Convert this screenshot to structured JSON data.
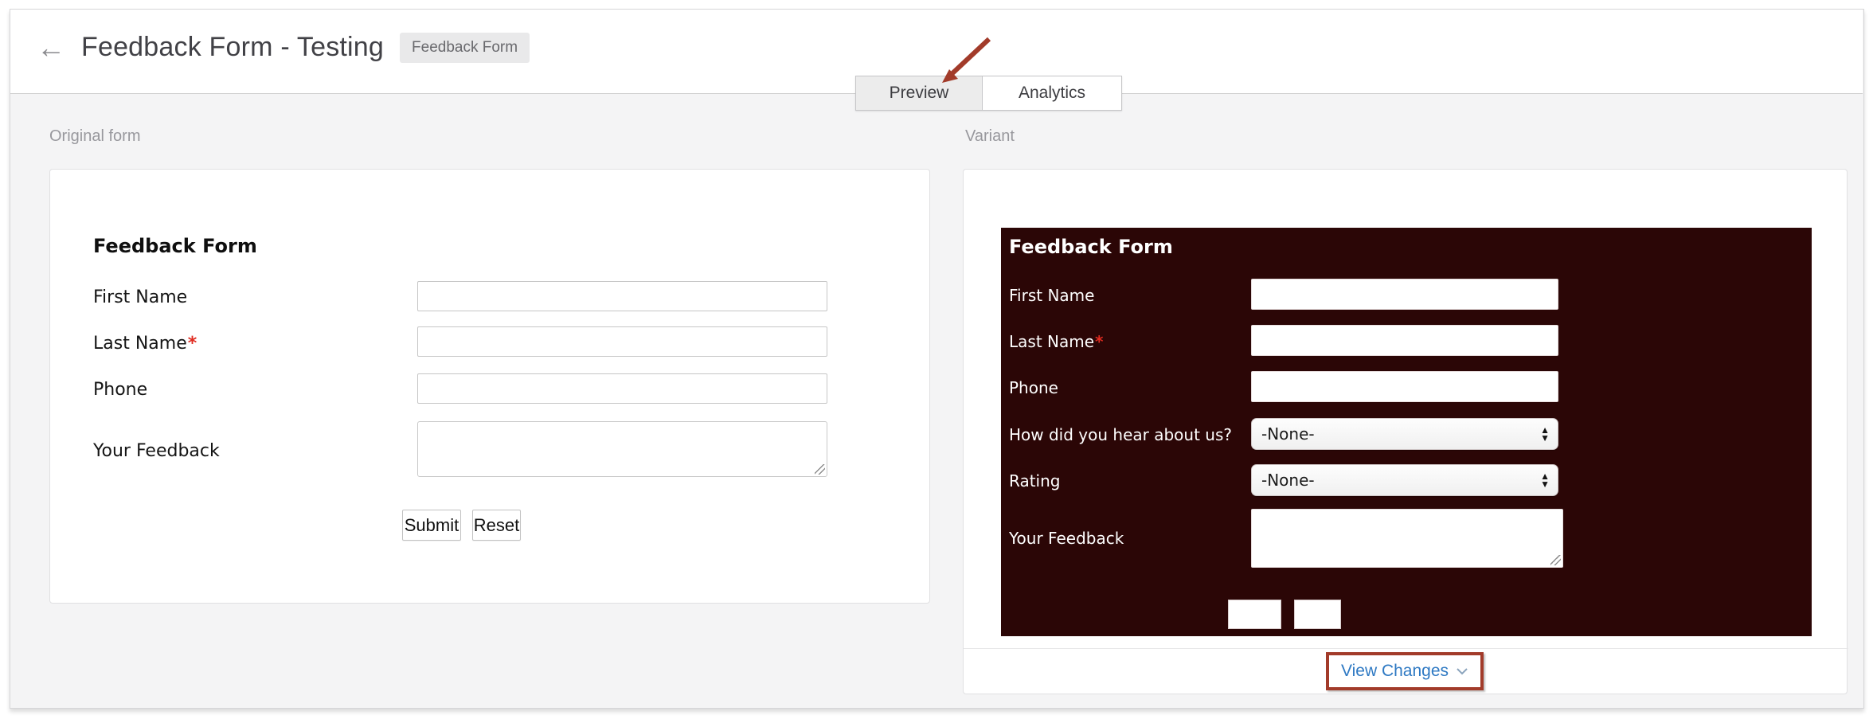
{
  "header": {
    "back_icon": "←",
    "title": "Feedback Form - Testing",
    "badge": "Feedback Form"
  },
  "tabs": {
    "preview": "Preview",
    "analytics": "Analytics"
  },
  "original": {
    "section_label": "Original form",
    "form_title": "Feedback Form",
    "fields": [
      {
        "label": "First Name",
        "marker": ""
      },
      {
        "label": "Last Name",
        "marker": "*"
      },
      {
        "label": "Phone",
        "marker": ""
      },
      {
        "label": "Your Feedback",
        "marker": ""
      }
    ],
    "submit_label": "Submit",
    "reset_label": "Reset"
  },
  "variant": {
    "section_label": "Variant",
    "form_title": "Feedback Form",
    "fields": [
      {
        "label": "First Name",
        "marker": ""
      },
      {
        "label": "Last Name",
        "marker": "*"
      },
      {
        "label": "Phone",
        "marker": ""
      },
      {
        "label": "How did you hear about us?",
        "marker": "",
        "value": "-None-"
      },
      {
        "label": "Rating",
        "marker": "",
        "value": "-None-"
      },
      {
        "label": "Your Feedback",
        "marker": ""
      }
    ],
    "button_1_label": "",
    "button_2_label": "",
    "view_changes_label": "View Changes"
  },
  "icons": {
    "select_up": "▲",
    "select_down": "▼"
  },
  "colors": {
    "variant_form_bg": "#2b0606",
    "annotation_red": "#a23b2a",
    "link_blue": "#2e79c3",
    "required_red": "#e02b20"
  }
}
